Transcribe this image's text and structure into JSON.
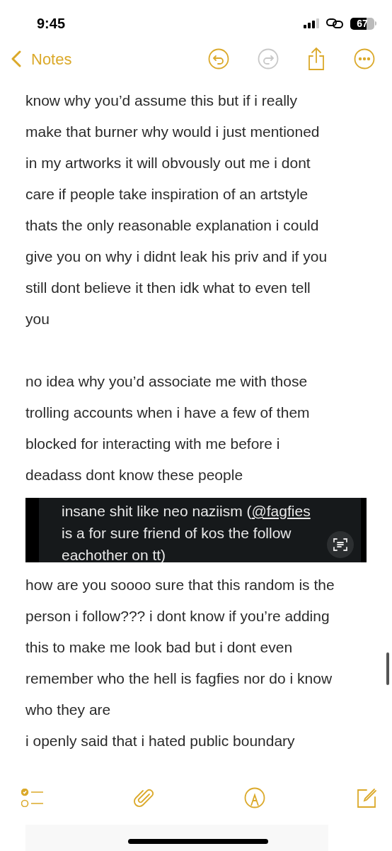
{
  "status_bar": {
    "time": "9:45",
    "battery": "67"
  },
  "nav": {
    "back_label": "Notes"
  },
  "paragraphs": [
    {
      "kind": "text",
      "lines": [
        "know why you’d assume this but if i really",
        "make that burner why would i just mentioned",
        "in my artworks it will obvously out me i dont",
        "care if people take inspiration of an artstyle",
        "thats the only reasonable explanation i could",
        "give you on why i didnt leak his priv and if you",
        "still dont believe it then idk what to even tell",
        "you"
      ]
    },
    {
      "kind": "blank"
    },
    {
      "kind": "text",
      "lines": [
        "no idea why you’d associate me with those",
        "trolling accounts when i have a few of them",
        "blocked for interacting with me before i",
        "deadass dont know these people"
      ]
    },
    {
      "kind": "screenshot",
      "before": "insane shit like neo naziism (",
      "link": "@fagfies",
      "after_lines": [
        "is a for sure friend of kos the follow",
        "eachother on tt)"
      ]
    },
    {
      "kind": "text",
      "lines": [
        "how are you soooo sure that this random is the",
        "person i follow??? i dont know if you’re adding",
        "this to make me look bad but i dont even",
        "remember who the hell is fagfies nor do i know",
        "who they are"
      ]
    },
    {
      "kind": "tight",
      "lines": [
        "i openly said that i hated public boundary"
      ]
    }
  ]
}
